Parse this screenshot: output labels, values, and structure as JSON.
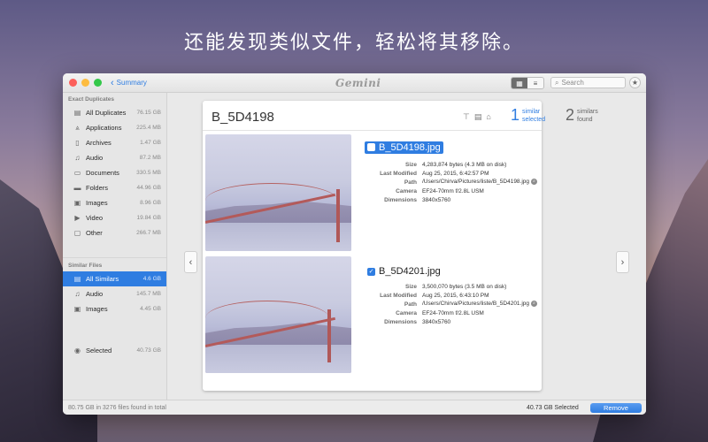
{
  "headline": "还能发现类似文件，轻松将其移除。",
  "window": {
    "back_label": "Summary",
    "app_logo": "Gemini",
    "search_placeholder": "Search"
  },
  "sidebar": {
    "section1_title": "Exact Duplicates",
    "items": [
      {
        "label": "All Duplicates",
        "size": "76.15 GB",
        "icon": "duplicates-icon"
      },
      {
        "label": "Applications",
        "size": "225.4 MB",
        "icon": "applications-icon"
      },
      {
        "label": "Archives",
        "size": "1.47 GB",
        "icon": "archive-icon"
      },
      {
        "label": "Audio",
        "size": "87.2 MB",
        "icon": "music-note-icon"
      },
      {
        "label": "Documents",
        "size": "330.5 MB",
        "icon": "document-icon"
      },
      {
        "label": "Folders",
        "size": "44.96 GB",
        "icon": "folder-icon"
      },
      {
        "label": "Images",
        "size": "8.96 GB",
        "icon": "image-icon"
      },
      {
        "label": "Video",
        "size": "19.84 GB",
        "icon": "film-icon"
      },
      {
        "label": "Other",
        "size": "266.7 MB",
        "icon": "file-icon"
      }
    ],
    "section2_title": "Similar Files",
    "similar_items": [
      {
        "label": "All Similars",
        "size": "4.6 GB",
        "icon": "similars-icon"
      },
      {
        "label": "Audio",
        "size": "145.7 MB",
        "icon": "music-note-icon"
      },
      {
        "label": "Images",
        "size": "4.45 GB",
        "icon": "image-icon"
      }
    ],
    "selected": {
      "label": "Selected",
      "size": "40.73 GB",
      "icon": "check-circle-icon"
    }
  },
  "card": {
    "title": "B_5D4198",
    "selected_count": "1",
    "selected_text1": "similar",
    "selected_text2": "selected",
    "found_count": "2",
    "found_text1": "similars",
    "found_text2": "found",
    "files": [
      {
        "name": "B_5D4198.jpg",
        "checked": false,
        "size": "4,283,874 bytes (4.3 MB on disk)",
        "modified": "Aug 25, 2015, 6:42:57 PM",
        "path": "/Users/Chirva/Pictures/liste/B_5D4198.jpg",
        "camera": "EF24-70mm f/2.8L USM",
        "dimensions": "3840x5760"
      },
      {
        "name": "B_5D4201.jpg",
        "checked": true,
        "size": "3,500,070 bytes (3.5 MB on disk)",
        "modified": "Aug 25, 2015, 6:43:10 PM",
        "path": "/Users/Chirva/Pictures/liste/B_5D4201.jpg",
        "camera": "EF24-70mm f/2.8L USM",
        "dimensions": "3840x5760"
      }
    ],
    "labels": {
      "size": "Size",
      "modified": "Last Modified",
      "path": "Path",
      "camera": "Camera",
      "dimensions": "Dimensions"
    }
  },
  "footer": {
    "info": "80.75 GB in 3276 files found in total",
    "selected": "40.73 GB Selected",
    "remove_label": "Remove"
  },
  "colors": {
    "accent": "#2f7de1"
  }
}
